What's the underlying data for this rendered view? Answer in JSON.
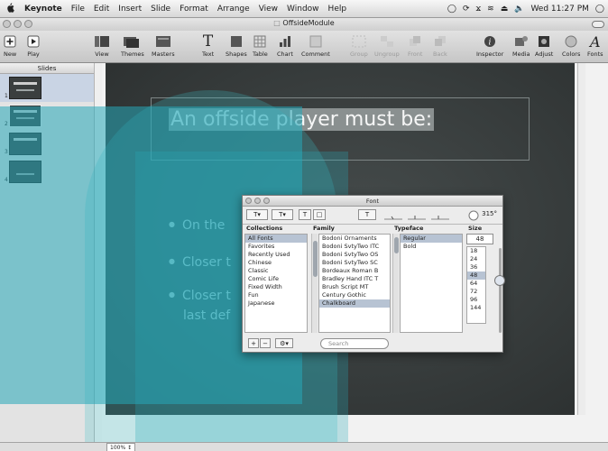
{
  "menubar": {
    "apple": "",
    "items": [
      "Keynote",
      "File",
      "Edit",
      "Insert",
      "Slide",
      "Format",
      "Arrange",
      "View",
      "Window",
      "Help"
    ],
    "clock": "Wed 11:27 PM"
  },
  "window": {
    "title": "OffsideModule"
  },
  "toolbar": {
    "new": "New",
    "play": "Play",
    "view": "View",
    "themes": "Themes",
    "masters": "Masters",
    "text": "Text",
    "shapes": "Shapes",
    "table": "Table",
    "chart": "Chart",
    "comment": "Comment",
    "group": "Group",
    "ungroup": "Ungroup",
    "front": "Front",
    "back": "Back",
    "inspector": "Inspector",
    "media": "Media",
    "adjust": "Adjust",
    "colors": "Colors",
    "fonts": "Fonts"
  },
  "navigator": {
    "header": "Slides",
    "slides": [
      "1",
      "2",
      "3",
      "4"
    ]
  },
  "slide": {
    "title": "An offside player must be:",
    "bullets": [
      "On the",
      "Closer t",
      "Closer t"
    ],
    "bullet_cont": "last def"
  },
  "zoom": "100%",
  "font_panel": {
    "title": "Font",
    "angle": "315°",
    "headers": {
      "collections": "Collections",
      "family": "Family",
      "typeface": "Typeface",
      "size": "Size"
    },
    "collections": [
      "All Fonts",
      "Favorites",
      "Recently Used",
      "Chinese",
      "Classic",
      "Comic Life",
      "Fixed Width",
      "Fun",
      "Japanese"
    ],
    "families": [
      "Bodoni Ornaments",
      "Bodoni SvtyTwo ITC",
      "Bodoni SvtyTwo OS",
      "Bodoni SvtyTwo SC",
      "Bordeaux Roman B",
      "Bradley Hand ITC T",
      "Brush Script MT",
      "Century Gothic",
      "Chalkboard"
    ],
    "typefaces": [
      "Regular",
      "Bold"
    ],
    "size_value": "48",
    "sizes": [
      "18",
      "24",
      "36",
      "48",
      "64",
      "72",
      "96",
      "144"
    ],
    "search_placeholder": "Search",
    "add": "+",
    "remove": "−",
    "gear": "⚙▾"
  },
  "colors": {
    "slide_bg": "#373c3c",
    "watermark": "#26a8b8"
  }
}
